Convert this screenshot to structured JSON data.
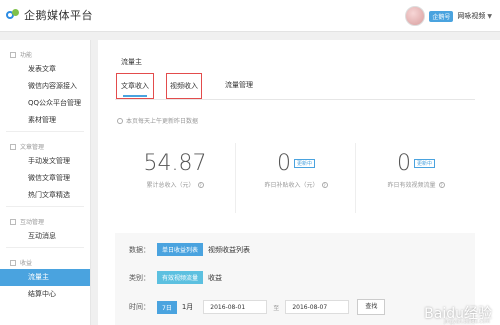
{
  "app": {
    "title": "企鹅媒体平台"
  },
  "user": {
    "badge": "企鹅号",
    "name": "网咏视频",
    "caret": "▼"
  },
  "sidebar": {
    "sections": [
      {
        "title": "功能",
        "items": [
          "发表文章",
          "微信内容源接入",
          "QQ公众平台管理",
          "素材管理"
        ]
      },
      {
        "title": "文章管理",
        "items": [
          "手动发文管理",
          "微信文章管理",
          "热门文章精选"
        ]
      },
      {
        "title": "互动管理",
        "items": [
          "互动消息"
        ]
      },
      {
        "title": "收益",
        "items": [
          "流量主",
          "结算中心"
        ]
      }
    ],
    "active": "流量主"
  },
  "main": {
    "title": "流量主",
    "tabs": [
      "文章收入",
      "视频收入",
      "流量管理"
    ],
    "note": "本页每天上午更新昨日数据",
    "stats": [
      {
        "value": "54.87",
        "label": "累计总收入（元）",
        "update": ""
      },
      {
        "value": "0",
        "label": "昨日补贴收入（元）",
        "update": "更新中"
      },
      {
        "value": "0",
        "label": "昨日有效视频流量",
        "update": "更新中"
      }
    ],
    "filters": {
      "data_label": "数据：",
      "data_chip": "单日收益列表",
      "data_option": "视频收益列表",
      "type_label": "类别：",
      "type_chip": "有效视频流量",
      "type_option": "收益",
      "time_label": "时间：",
      "time_chip": "7日",
      "time_option": "1月",
      "date_from": "2016-08-01",
      "date_sep": "至",
      "date_to": "2016-08-07",
      "search_label": "查找"
    }
  },
  "watermark": {
    "text": "Baidu经验",
    "sub": "jingyan.baidu.com"
  }
}
